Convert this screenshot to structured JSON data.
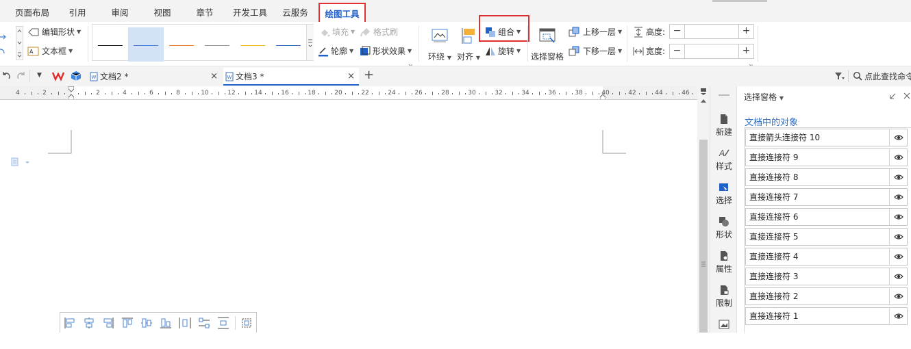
{
  "menu": {
    "tabs": [
      {
        "label": "页面布局"
      },
      {
        "label": "引用"
      },
      {
        "label": "审阅"
      },
      {
        "label": "视图"
      },
      {
        "label": "章节"
      },
      {
        "label": "开发工具"
      },
      {
        "label": "云服务"
      },
      {
        "label": "绘图工具",
        "active": true
      }
    ]
  },
  "ribbon": {
    "edit_shape": "编辑形状",
    "text_box": "文本框",
    "fill": "填充",
    "format_brush": "格式刷",
    "outline": "轮廓",
    "shape_effects": "形状效果",
    "wrap": "环绕",
    "align": "对齐",
    "group": "组合",
    "rotate": "旋转",
    "selection_pane": "选择窗格",
    "bring_forward": "上移一层",
    "send_backward": "下移一层",
    "height_label": "高度:",
    "width_label": "宽度:",
    "height_value": "",
    "width_value": "",
    "line_style_colors": [
      "#222222",
      "#4a86d6",
      "#e8823c",
      "#9a9a9a",
      "#e8c22a",
      "#3d6fbf"
    ]
  },
  "docbar": {
    "tabs": [
      {
        "label": "文档2 *"
      },
      {
        "label": "文档3 *",
        "active": true
      }
    ],
    "search_placeholder": "点此查找命令"
  },
  "ruler": {
    "labels": [
      "4",
      "2",
      "",
      "2",
      "4",
      "6",
      "8",
      "10",
      "12",
      "14",
      "16",
      "18",
      "20",
      "22",
      "24",
      "26",
      "28",
      "30",
      "32",
      "34",
      "36",
      "38",
      "40",
      "42",
      "44",
      "46"
    ]
  },
  "sidebar": {
    "items": [
      {
        "label": "新建",
        "icon": "new-doc-icon"
      },
      {
        "label": "样式",
        "icon": "style-icon"
      },
      {
        "label": "选择",
        "icon": "select-icon"
      },
      {
        "label": "形状",
        "icon": "shape-icon"
      },
      {
        "label": "属性",
        "icon": "property-icon"
      },
      {
        "label": "限制",
        "icon": "restrict-icon"
      },
      {
        "label": "",
        "icon": "image-icon"
      }
    ]
  },
  "pane": {
    "title": "选择窗格",
    "section": "文档中的对象",
    "objects": [
      "直接箭头连接符 10",
      "直接连接符 9",
      "直接连接符 8",
      "直接连接符 7",
      "直接连接符 6",
      "直接连接符 5",
      "直接连接符 4",
      "直接连接符 3",
      "直接连接符 2",
      "直接连接符 1"
    ]
  },
  "colors": {
    "accent": "#1f60c9",
    "highlight": "#e03030",
    "section_title": "#2e6fbf"
  }
}
